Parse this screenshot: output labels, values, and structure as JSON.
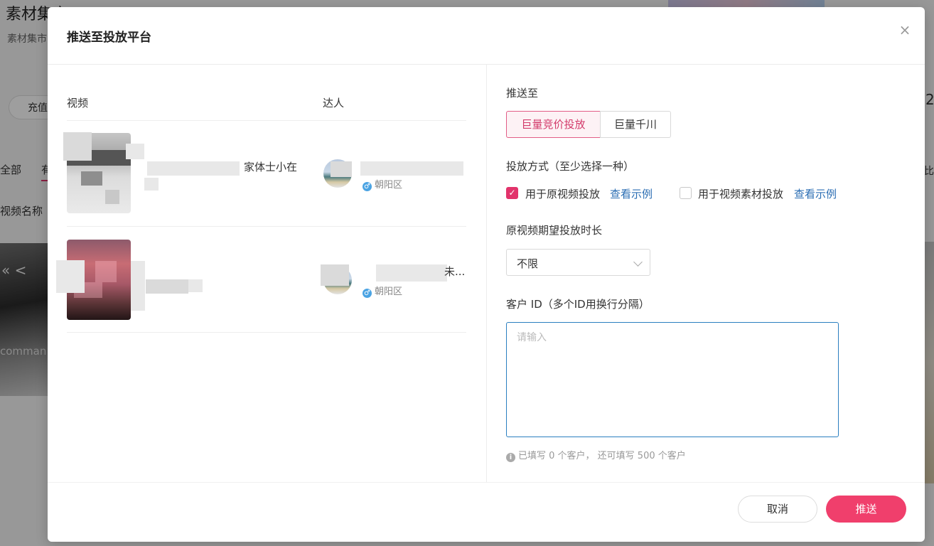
{
  "background": {
    "title": "素材集市",
    "breadcrumb": "素材集市",
    "recharge_button": "充值",
    "tab_all": "全部",
    "tab_second": "有",
    "column_video_name": "视频名称",
    "command_text": "comman",
    "right_number": "2",
    "right_text": "比",
    "keys_text": "« <"
  },
  "modal": {
    "title": "推送至投放平台",
    "close_icon": "close-icon",
    "table": {
      "headers": {
        "video": "视频",
        "creator": "达人"
      },
      "rows": [
        {
          "title_visible": "家体士小在",
          "creator_name_tail": "",
          "location": "朝阳区"
        },
        {
          "title_visible": "",
          "creator_name_tail": "未...",
          "location": "朝阳区"
        }
      ]
    },
    "form": {
      "push_to_label": "推送至",
      "platforms": [
        "巨量竞价投放",
        "巨量千川"
      ],
      "selected_platform": "巨量竞价投放",
      "method_label": "投放方式（至少选择一种）",
      "methods": [
        {
          "label": "用于原视频投放",
          "checked": true,
          "link": "查看示例"
        },
        {
          "label": "用于视频素材投放",
          "checked": false,
          "link": "查看示例"
        }
      ],
      "duration_label": "原视频期望投放时长",
      "duration_value": "不限",
      "client_id_label": "客户 ID（多个ID用换行分隔）",
      "client_id_placeholder": "请输入",
      "client_id_value": "",
      "hint": "已填写 0 个客户， 还可填写 500 个客户"
    },
    "footer": {
      "cancel": "取消",
      "submit": "推送"
    },
    "colors": {
      "accent": "#f03f6c",
      "link": "#2a6db3",
      "focus_border": "#2a7fc0"
    }
  }
}
